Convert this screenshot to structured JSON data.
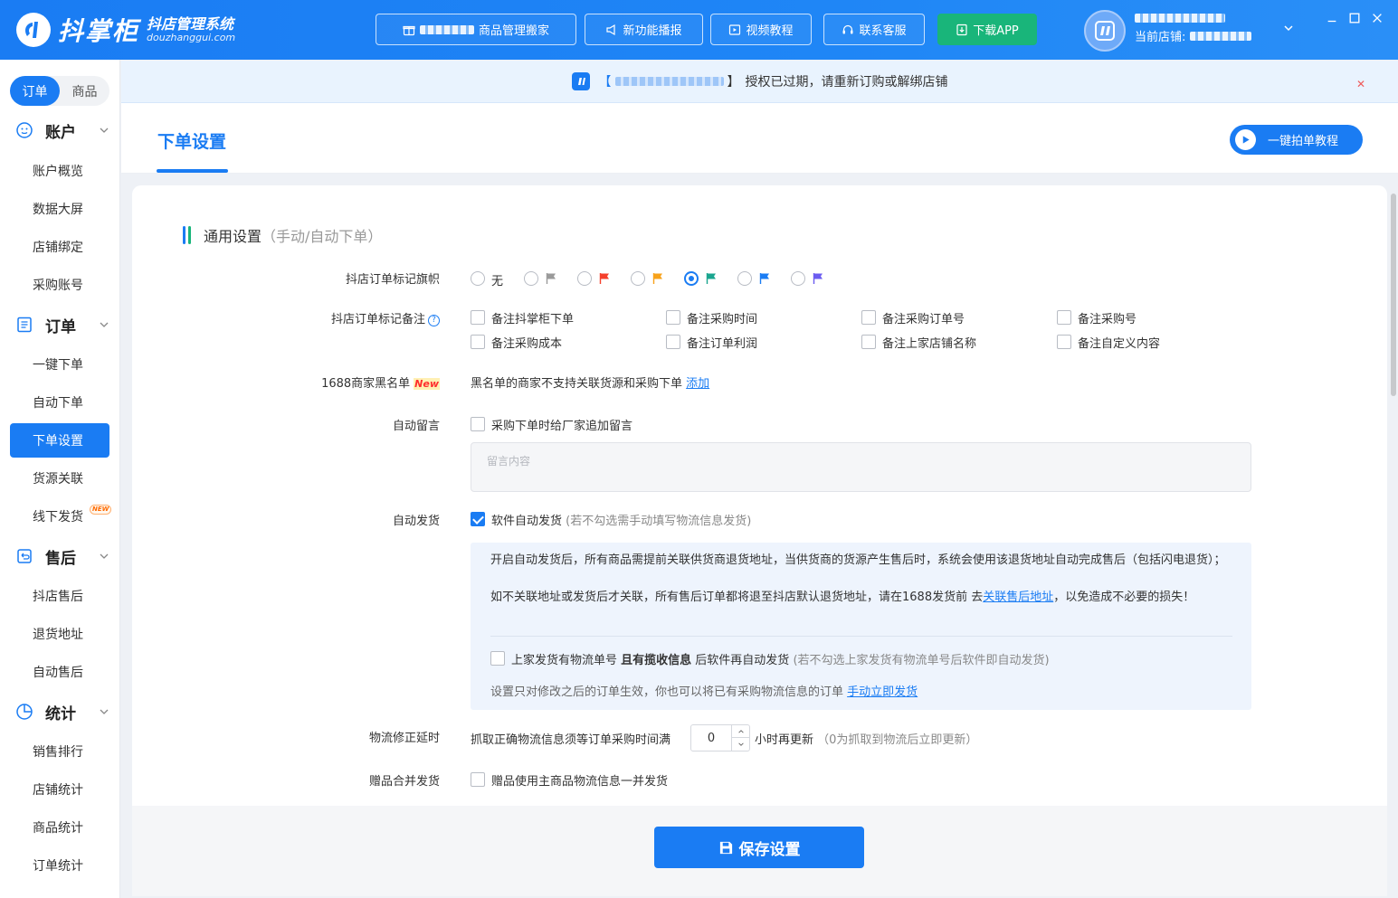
{
  "app": {
    "name": "抖掌柜",
    "subtitle": "抖店管理系统",
    "domain": "douzhanggui.com"
  },
  "topbar": {
    "buttons": [
      {
        "label": "商品管理搬家",
        "icon": "gift-icon"
      },
      {
        "label": "新功能播报",
        "icon": "megaphone-icon"
      },
      {
        "label": "视频教程",
        "icon": "video-icon"
      },
      {
        "label": "联系客服",
        "icon": "headset-icon"
      },
      {
        "label": "下载APP",
        "icon": "download-icon"
      }
    ],
    "store_label": "当前店铺:"
  },
  "sidebar": {
    "tabs": [
      "订单",
      "商品"
    ],
    "groups": [
      {
        "label": "账户",
        "icon": "smiley-icon",
        "items": [
          "账户概览",
          "数据大屏",
          "店铺绑定",
          "采购账号"
        ]
      },
      {
        "label": "订单",
        "icon": "list-icon",
        "items": [
          "一键下单",
          "自动下单",
          "下单设置",
          "货源关联",
          "线下发货"
        ]
      },
      {
        "label": "售后",
        "icon": "return-icon",
        "items": [
          "抖店售后",
          "退货地址",
          "自动售后"
        ]
      },
      {
        "label": "统计",
        "icon": "pie-icon",
        "items": [
          "销售排行",
          "店铺统计",
          "商品统计",
          "订单统计"
        ]
      }
    ],
    "active_item": "下单设置",
    "new_tag": "NEW"
  },
  "notice": {
    "bracket_open": "【",
    "bracket_close": "】",
    "text": "授权已过期，请重新订购或解绑店铺"
  },
  "page": {
    "title": "下单设置",
    "tutorial_button": "一键拍单教程",
    "section_title": "通用设置",
    "section_subtitle": "（手动/自动下单）"
  },
  "form": {
    "flag": {
      "label": "抖店订单标记旗帜",
      "none_label": "无",
      "options": [
        {
          "id": "none",
          "color": ""
        },
        {
          "id": "grey",
          "color": "#9a9a9a"
        },
        {
          "id": "red",
          "color": "#f5402c"
        },
        {
          "id": "orange",
          "color": "#f7a21b"
        },
        {
          "id": "green",
          "color": "#1aa58f"
        },
        {
          "id": "blue",
          "color": "#1a7cf3"
        },
        {
          "id": "purple",
          "color": "#6b5cf0"
        }
      ],
      "selected": "green"
    },
    "remark": {
      "label": "抖店订单标记备注",
      "options": [
        {
          "label": "备注抖掌柜下单",
          "checked": false
        },
        {
          "label": "备注采购时间",
          "checked": false
        },
        {
          "label": "备注采购订单号",
          "checked": false
        },
        {
          "label": "备注采购号",
          "checked": false
        },
        {
          "label": "备注采购成本",
          "checked": false
        },
        {
          "label": "备注订单利润",
          "checked": false
        },
        {
          "label": "备注上家店铺名称",
          "checked": false
        },
        {
          "label": "备注自定义内容",
          "checked": false
        }
      ]
    },
    "blacklist": {
      "label": "1688商家黑名单",
      "badge": "New",
      "text": "黑名单的商家不支持关联货源和采购下单",
      "link": "添加"
    },
    "auto_message": {
      "label": "自动留言",
      "checkbox": "采购下单时给厂家追加留言",
      "checked": false,
      "placeholder": "留言内容"
    },
    "auto_ship": {
      "label": "自动发货",
      "checkbox": "软件自动发货",
      "hint": "(若不勾选需手动填写物流信息发货)",
      "checked": true,
      "info_line1": "开启自动发货后，所有商品需提前关联供货商退货地址，当供货商的货源产生售后时，系统会使用该退货地址自动完成售后（包括闪电退货）；",
      "info_line2_pre": "如不关联地址或发货后才关联，所有售后订单都将退至抖店默认退货地址，请在1688发货前 去",
      "info_line2_link": "关联售后地址",
      "info_line2_post": "，以免造成不必要的损失！",
      "sub_checkbox_pre": "上家发货有物流单号 ",
      "sub_checkbox_bold": "且有揽收信息",
      "sub_checkbox_post": " 后软件再自动发货",
      "sub_hint": "(若不勾选上家发货有物流单号后软件即自动发货)",
      "sub_checked": false,
      "note_pre": "设置只对修改之后的订单生效，你也可以将已有采购物流信息的订单 ",
      "note_link": "手动立即发货"
    },
    "logistics_delay": {
      "label": "物流修正延时",
      "text_pre": "抓取正确物流信息须等订单采购时间满",
      "value": "0",
      "text_post": "小时再更新",
      "hint": "（0为抓取到物流后立即更新）"
    },
    "gift_merge": {
      "label": "赠品合并发货",
      "checkbox": "赠品使用主商品物流信息一并发货",
      "checked": false
    }
  },
  "save_button": "保存设置",
  "colors": {
    "primary": "#1a7cf3",
    "success": "#19b57a",
    "danger": "#ef5a5a"
  }
}
